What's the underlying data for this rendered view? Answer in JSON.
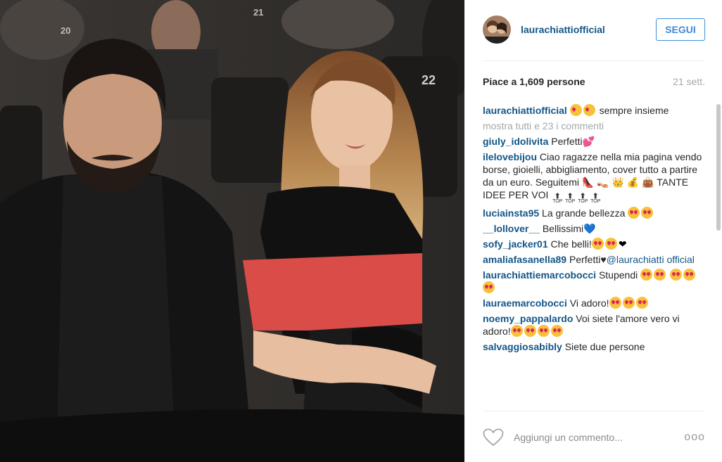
{
  "post": {
    "username": "laurachiattiofficial",
    "follow_label": "SEGUI",
    "likes_text": "Piace a 1,609 persone",
    "time_text": "21 sett.",
    "caption_text": " sempre insieme",
    "more_comments": "mostra tutti e 23 i commenti",
    "photo_seat_labels": [
      "20",
      "21",
      "22"
    ]
  },
  "comments": [
    {
      "user": "giuly_idolivita",
      "text": "Perfetti"
    },
    {
      "user": "ilelovebijou",
      "text": "Ciao ragazze nella mia pagina vendo borse, gioielli, abbigliamento, cover tutto a partire da un euro. Seguitemi",
      "text2": "TANTE IDEE PER VOI"
    },
    {
      "user": "luciainsta95",
      "text": "La grande bellezza"
    },
    {
      "user": "__lollover__",
      "text": "Bellissimi"
    },
    {
      "user": "sofy_jacker01",
      "text": "Che belli!"
    },
    {
      "user": "amaliafasanella89",
      "text": "Perfetti",
      "mention": "@laurachiatti official"
    },
    {
      "user": "laurachiattiemarcobocci",
      "text": "Stupendi"
    },
    {
      "user": "lauraemarcobocci",
      "text": "Vi adoro!"
    },
    {
      "user": "noemy_pappalardo",
      "text": "Voi siete l'amore vero vi adoro!"
    },
    {
      "user": "salvaggiosabibly",
      "text": "Siete due persone"
    }
  ],
  "top_badge": "TOP",
  "footer": {
    "placeholder": "Aggiungi un commento...",
    "more": "ooo"
  },
  "colors": {
    "username": "#125688",
    "follow_border": "#4090db",
    "muted": "#a5a7aa"
  },
  "icons": [
    "heart-outline-icon",
    "more-options-icon",
    "avatar"
  ]
}
